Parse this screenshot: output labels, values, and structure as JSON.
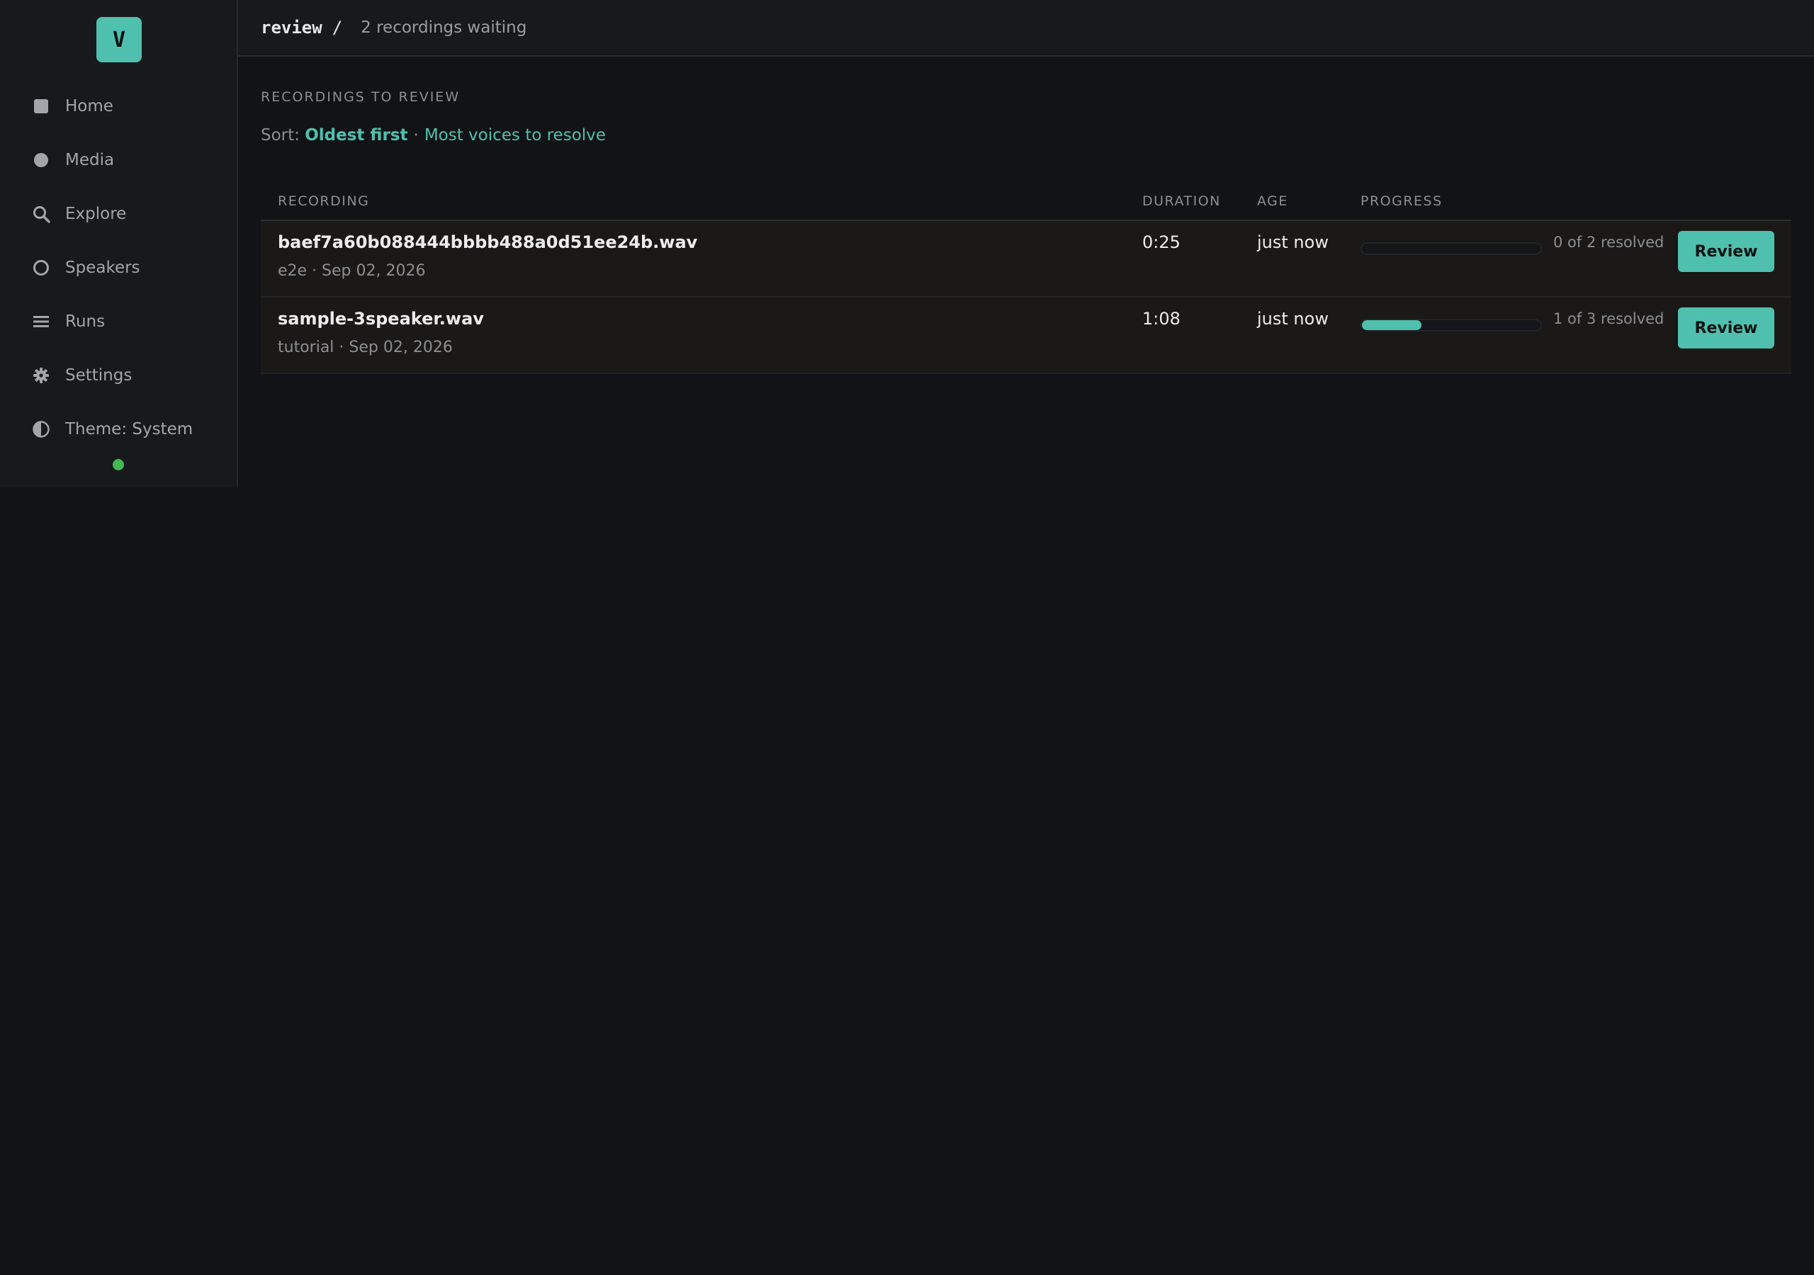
{
  "app": {
    "logo_letter": "V"
  },
  "sidebar": {
    "items": [
      {
        "label": "Home",
        "icon": "square-icon"
      },
      {
        "label": "Media",
        "icon": "circle-filled-icon"
      },
      {
        "label": "Explore",
        "icon": "search-icon"
      },
      {
        "label": "Speakers",
        "icon": "circle-outline-icon"
      },
      {
        "label": "Runs",
        "icon": "list-icon"
      },
      {
        "label": "Settings",
        "icon": "gear-icon"
      },
      {
        "label": "Theme: System",
        "icon": "half-circle-icon"
      }
    ],
    "status_color": "#3fb950"
  },
  "header": {
    "crumb": "review",
    "separator": "/",
    "subtitle": "2 recordings waiting"
  },
  "section": {
    "title": "RECORDINGS TO REVIEW",
    "sort_prefix": "Sort:",
    "sort_active": "Oldest first",
    "sort_separator": "·",
    "sort_other": "Most voices to resolve"
  },
  "table": {
    "columns": [
      "RECORDING",
      "DURATION",
      "AGE",
      "PROGRESS"
    ],
    "rows": [
      {
        "name": "baef7a60b088444bbbb488a0d51ee24b.wav",
        "meta": "e2e · Sep 02, 2026",
        "duration": "0:25",
        "age": "just now",
        "progress": 0,
        "resolved": "0 of 2 resolved",
        "action": "Review"
      },
      {
        "name": "sample-3speaker.wav",
        "meta": "tutorial · Sep 02, 2026",
        "duration": "1:08",
        "age": "just now",
        "progress": 0.333,
        "resolved": "1 of 3 resolved",
        "action": "Review"
      }
    ]
  },
  "colors": {
    "accent": "#4fc0ad",
    "background": "#121316",
    "sidebar": "#18191c"
  }
}
